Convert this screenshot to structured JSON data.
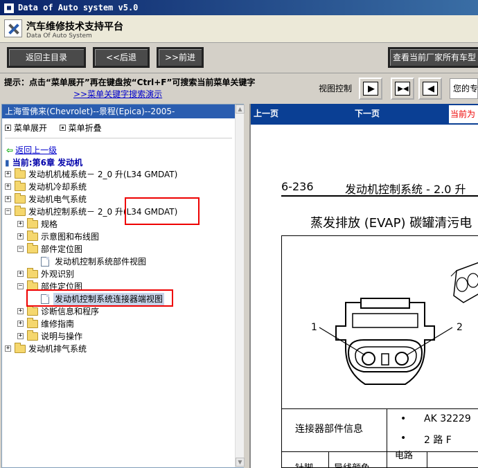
{
  "window": {
    "title": "Data of Auto system v5.0"
  },
  "banner": {
    "title": "汽车维修技术支持平台",
    "subtitle": "Data Of Auto System"
  },
  "toolbar": {
    "home": "返回主目录",
    "back": "<<后退",
    "forward": ">>前进",
    "all_models": "查看当前厂家所有车型"
  },
  "hint": {
    "text": "提示：点击“菜单展开”再在键盘按“Ctrl+F”可搜索当前菜单关键字",
    "link": ">>菜单关键字搜索演示",
    "view_label": "视图控制",
    "welcome": "您的专"
  },
  "left": {
    "car": "上海雪佛来(Chevrolet)--景程(Epica)--2005-",
    "expand": "菜单展开",
    "collapse": "菜单折叠",
    "back": "返回上一级",
    "current": "当前:第6章 发动机",
    "tree": {
      "n0": "发动机机械系统－ 2_0 升(L34 GMDAT)",
      "n1": "发动机冷却系统",
      "n2": "发动机电气系统",
      "n3": "发动机控制系统－ 2_0 升(L34 GMDAT)",
      "n4": "规格",
      "n5": "示意图和布线图",
      "n6": "部件定位图",
      "n7": "发动机控制系统部件视图",
      "n8": "外观识别",
      "n9": "部件定位图",
      "n10": "发动机控制系统连接器端视图",
      "n11": "诊断信息和程序",
      "n12": "维修指南",
      "n13": "说明与操作",
      "n14": "发动机排气系统"
    }
  },
  "right": {
    "prev": "上一页",
    "next": "下一页",
    "current": "当前为",
    "page_num": "6-236",
    "page_title": "发动机控制系统 - 2.0 升",
    "section": "蒸发排放 (EVAP) 碳罐清污电",
    "callout1": "1",
    "callout2": "2",
    "info_label": "连接器部件信息",
    "info1": "AK 32229",
    "info2": "2 路 F",
    "col1": "针脚",
    "col2": "导线颜色",
    "col3": "电路"
  }
}
